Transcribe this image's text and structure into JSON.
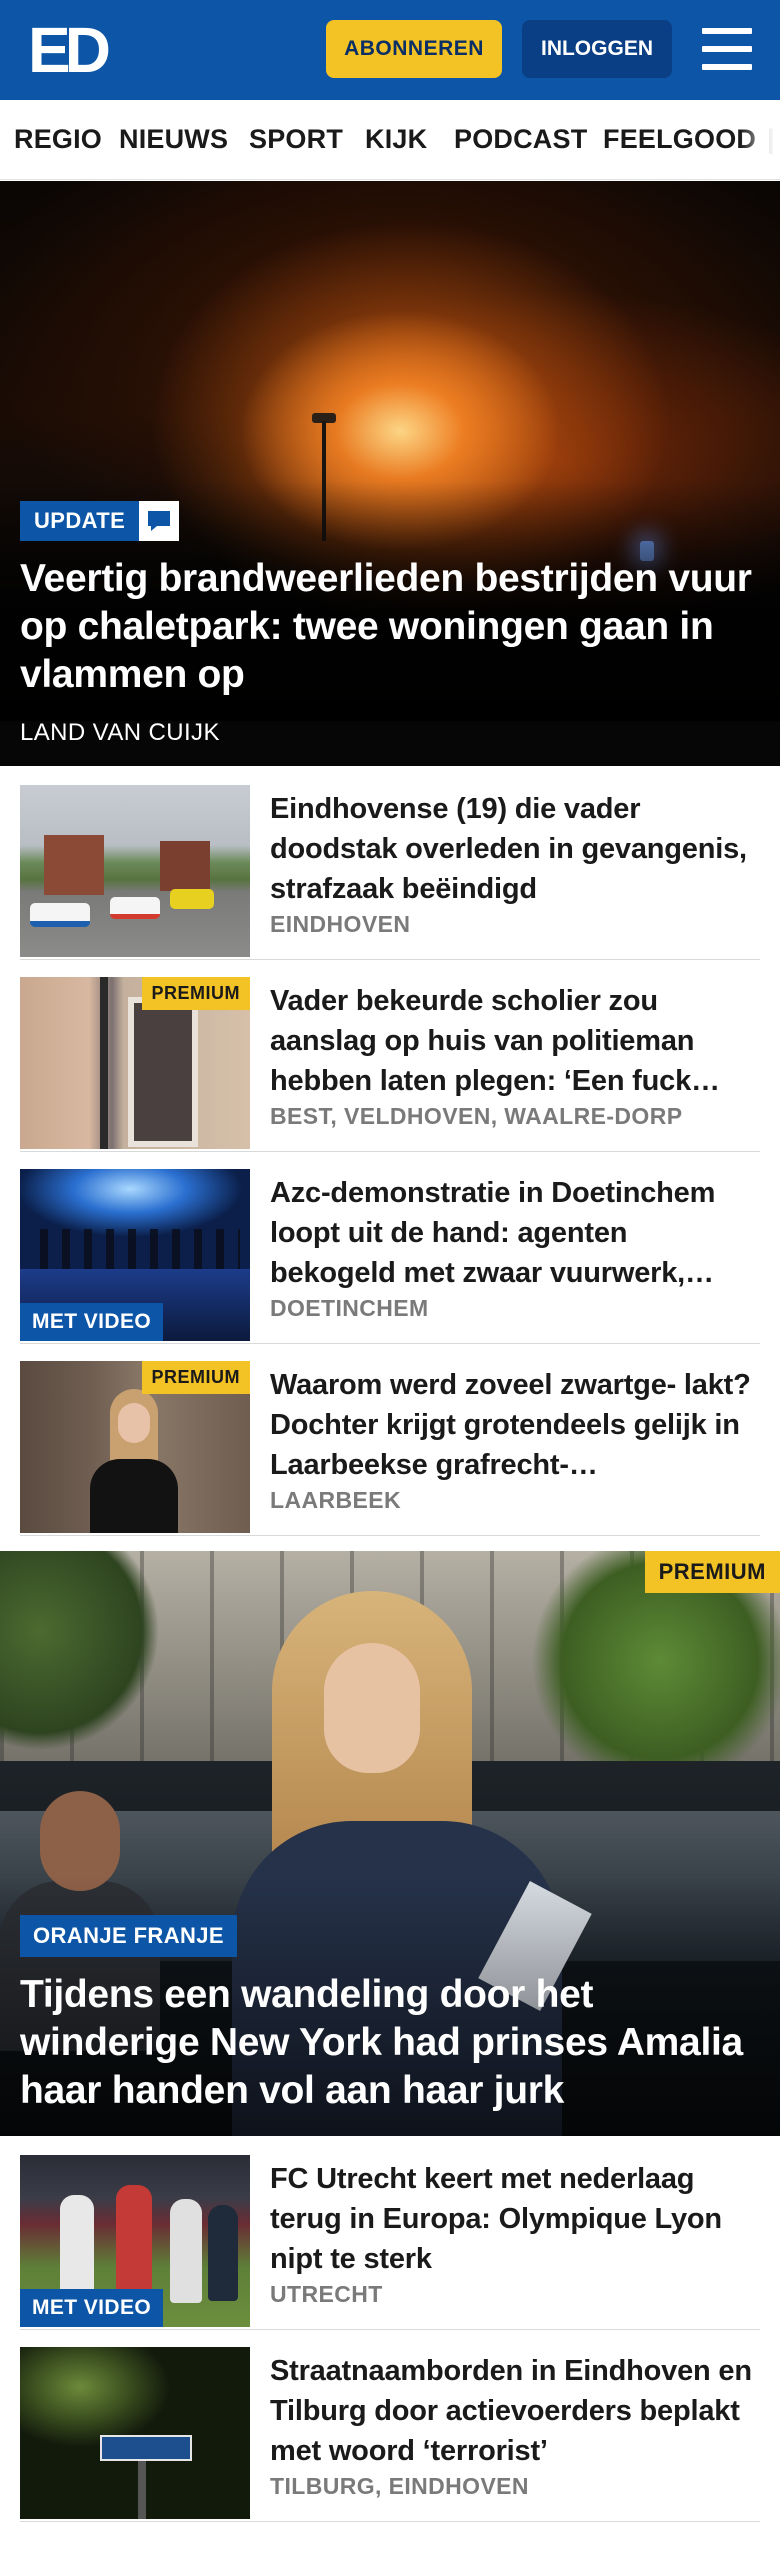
{
  "header": {
    "logo_text": "ED",
    "subscribe_label": "ABONNEREN",
    "login_label": "INLOGGEN",
    "menu_icon": "hamburger-menu-icon",
    "colors": {
      "brand_blue": "#0d55a6",
      "accent_yellow": "#f3c224"
    }
  },
  "nav": {
    "items": [
      "REGIO",
      "NIEUWS",
      "SPORT",
      "KIJK",
      "PODCAST",
      "FEELGOOD"
    ]
  },
  "hero1": {
    "badge": "UPDATE",
    "badge_icon": "comment-icon",
    "title": "Veertig brandweerlieden bestrijden vuur op chaletpark: twee woningen gaan in vlammen op",
    "location": "LAND VAN CUIJK"
  },
  "articles": [
    {
      "title": "Eindhovense (19) die vader doodstak overleden in gevangenis, strafzaak beëindigd",
      "location": "EINDHOVEN"
    },
    {
      "tag": "PREMIUM",
      "title": "Vader bekeurde scholier zou aanslag op huis van politieman hebben laten plegen: ‘Een fuck…",
      "location": "BEST, VELDHOVEN, WAALRE-DORP"
    },
    {
      "tag": "MET VIDEO",
      "title": "Azc-demonstratie in Doetinchem loopt uit de hand: agenten bekogeld met zwaar vuurwerk,…",
      "location": "DOETINCHEM"
    },
    {
      "tag": "PREMIUM",
      "title": "Waarom werd zoveel zwartge- lakt? Dochter krijgt grotendeels gelijk in Laarbeekse grafrecht-…",
      "location": "LAARBEEK"
    }
  ],
  "hero2": {
    "premium": "PREMIUM",
    "badge": "ORANJE FRANJE",
    "title": "Tijdens een wandeling door het winderige New York had prinses Amalia haar handen vol aan haar jurk"
  },
  "articles2": [
    {
      "tag": "MET VIDEO",
      "title": "FC Utrecht keert met nederlaag terug in Europa: Olympique Lyon nipt te sterk",
      "location": "UTRECHT"
    },
    {
      "title": "Straatnaamborden in Eindhoven en Tilburg door actievoerders beplakt met woord ‘terrorist’",
      "location": "TILBURG, EINDHOVEN"
    }
  ]
}
